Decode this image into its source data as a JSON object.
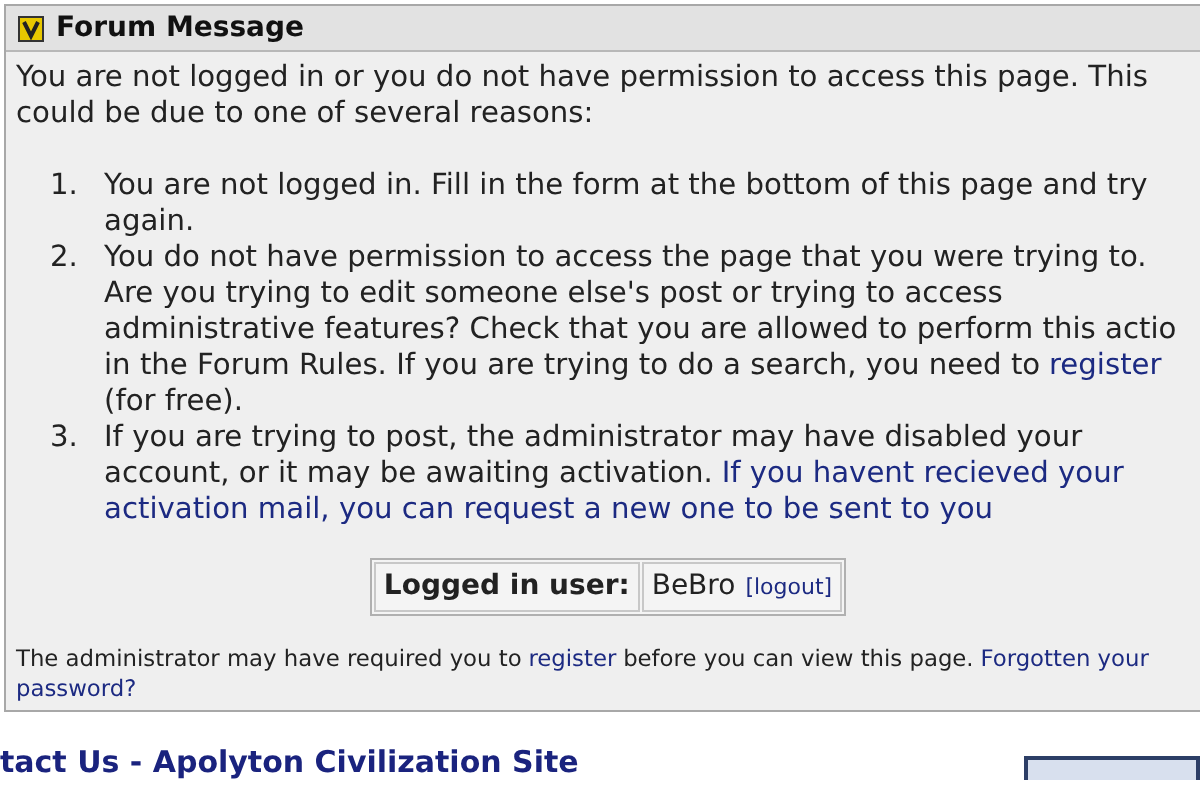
{
  "panel": {
    "title": "Forum Message",
    "intro": [
      [
        {
          "text": "You are not logged in or you do not have permission to access this page. This"
        }
      ],
      [
        {
          "text": "could be due to one of several reasons:"
        }
      ]
    ],
    "reasons": [
      {
        "number": "1.",
        "lines": [
          [
            {
              "text": "You are not logged in. Fill in the form at the bottom of this page and try"
            }
          ],
          [
            {
              "text": "again."
            }
          ]
        ]
      },
      {
        "number": "2.",
        "lines": [
          [
            {
              "text": "You do not have permission to access the page that you were trying to."
            }
          ],
          [
            {
              "text": "Are you trying to edit someone else's post or trying to access"
            }
          ],
          [
            {
              "text": "administrative features? Check that you are allowed to perform this actio"
            }
          ],
          [
            {
              "text": "in the Forum Rules. If you are trying to do a search, you need to"
            },
            {
              "text": "register",
              "link": true
            }
          ],
          [
            {
              "text": "(for free)."
            }
          ]
        ]
      },
      {
        "number": "3.",
        "lines": [
          [
            {
              "text": "If you are trying to post, the administrator may have disabled your"
            }
          ],
          [
            {
              "text": "account, or it may be awaiting activation."
            },
            {
              "text": "If you havent recieved your",
              "link": true
            }
          ],
          [
            {
              "text": "activation mail, you can request a new one to be sent to you",
              "link": true
            }
          ]
        ]
      }
    ],
    "login": {
      "label": "Logged in user:",
      "user": "BeBro",
      "logout": "[logout]"
    },
    "footer": [
      [
        {
          "text": "The administrator may have required you to"
        },
        {
          "text": "register",
          "link": true
        },
        {
          "text": "before you can view this page."
        },
        {
          "text": "Forgotten your",
          "link": true
        }
      ],
      [
        {
          "text": "password?",
          "link": true
        }
      ]
    ]
  },
  "heading": "tact Us - Apolyton Civilization Site"
}
